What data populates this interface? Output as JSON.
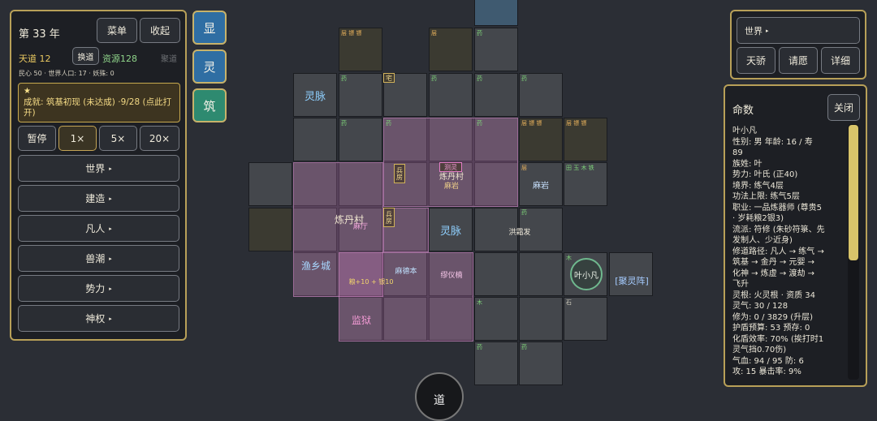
{
  "left": {
    "year": "第 33 年",
    "menu_label": "菜单",
    "collapse_label": "收起",
    "tiandao": "天道 12",
    "switch_label": "换道",
    "resources": "资源128",
    "juyi": "聚道",
    "stats": "民心 50 · 世界人口: 17 · 妖殊: 0",
    "achievement_star": "★",
    "achievement_text": "成就: 筑基初现 (未达成) ·9/28 (点此打开)",
    "speeds": [
      "暂停",
      "1×",
      "5×",
      "20×"
    ],
    "menu_items": [
      "世界",
      "建造",
      "凡人",
      "兽潮",
      "势力",
      "神权"
    ]
  },
  "side_buttons": [
    "显",
    "灵",
    "筑"
  ],
  "right_top": {
    "world_label": "世界",
    "buttons": [
      "天骄",
      "请愿",
      "详细"
    ]
  },
  "fate": {
    "title": "命数",
    "close_label": "关闭",
    "lines": [
      "叶小凡",
      "性别: 男  年龄: 16 / 寿",
      "89",
      "族姓: 叶",
      "势力: 叶氏 (正40)",
      "境界: 练气4层",
      "功法上限: 练气5层",
      "职业: 一品炼器师 (尊贵5",
      "· 岁耗粮2银3)",
      "流派: 符修 (朱砂符箓、先",
      "发制人、少近身)",
      "修道路径: 凡人 → 练气 →",
      "筑基 → 金丹 → 元婴 →",
      "化神 → 炼虚 → 渡劫 →",
      "飞升",
      "灵根: 火灵根 · 资质 34",
      "灵气: 30 / 128",
      "修为: 0 / 3829 (升层)",
      "护盾预算: 53  预存: 0",
      "化盾效率: 70% (挨打时1",
      "灵气挡0.70伤)",
      "气血: 94 / 95  防: 6",
      "攻: 15  暴击率: 9%"
    ]
  },
  "map": {
    "lingmai_1": "灵脉",
    "lingmai_2": "灵脉",
    "zhai": "宅",
    "yao": "药",
    "shi": "石",
    "mu": "木",
    "ceng": "层",
    "ceng_tag": "层 镖 镖",
    "wood_tag": "田 玉 木 铁",
    "bing_fang": "兵房",
    "ceyling": "测灵",
    "lianqi_town": "炼丹村",
    "ma_yan": "麻岩",
    "ma_yan2": "麻岩",
    "lian_dan": "炼丹村",
    "liandan_sub": "麻厅",
    "hong_tan": "洪霜发",
    "yu_xiang": "渔乡城",
    "mu_de_ben": "麻德本",
    "lv_yi": "缪仪楠",
    "jian_yu": "监狱",
    "ye_xiaofan": "叶小凡",
    "ju_ling": "[聚灵阵]",
    "liang_text": "粮+10 + 银10",
    "bottom_circle": "道"
  }
}
